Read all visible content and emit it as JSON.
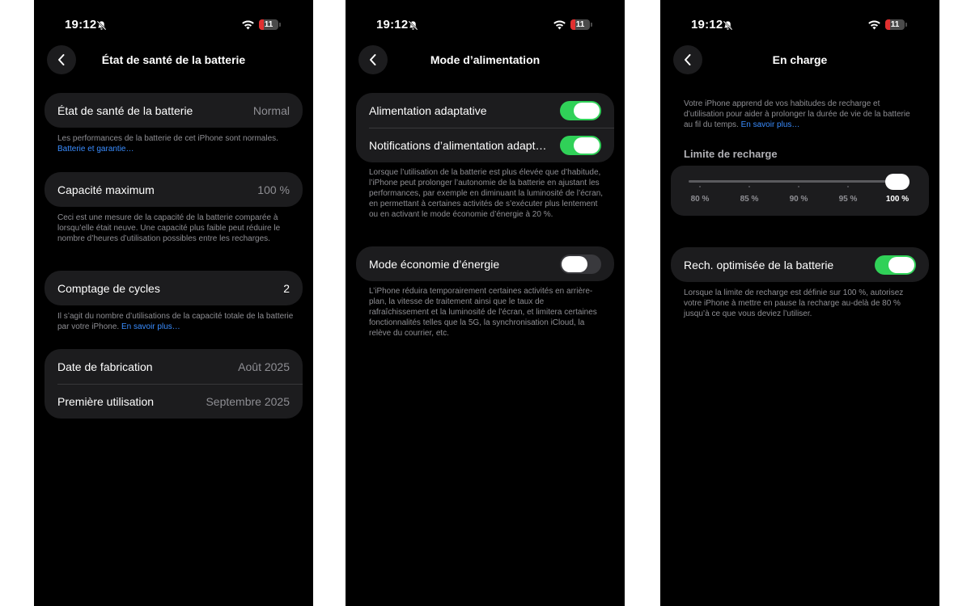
{
  "status_bar": {
    "time": "19:12",
    "battery": "11"
  },
  "screen1": {
    "title": "État de santé de la batterie",
    "health": {
      "label": "État de santé de la batterie",
      "value": "Normal"
    },
    "health_note": "Les performances de la batterie de cet iPhone sont normales.",
    "health_link": "Batterie et garantie…",
    "capacity": {
      "label": "Capacité maximum",
      "value": "100 %"
    },
    "capacity_note": "Ceci est une mesure de la capacité de la batterie comparée à lorsqu’elle était neuve. Une capacité plus faible peut réduire le nombre d’heures d’utilisation possibles entre les recharges.",
    "cycles": {
      "label": "Comptage de cycles",
      "value": "2"
    },
    "cycles_note": "Il s’agit du nombre d’utilisations de la capacité totale de la batterie par votre iPhone.",
    "cycles_link": "En savoir plus…",
    "manufacture": {
      "label": "Date de fabrication",
      "value": "Août 2025"
    },
    "first_use": {
      "label": "Première utilisation",
      "value": "Septembre 2025"
    }
  },
  "screen2": {
    "title": "Mode d’alimentation",
    "adaptive": {
      "label": "Alimentation adaptative",
      "on": true
    },
    "notifications": {
      "label": "Notifications d’alimentation adaptative",
      "on": true
    },
    "adaptive_note": "Lorsque l’utilisation de la batterie est plus élevée que d’habitude, l’iPhone peut prolonger l’autonomie de la batterie en ajustant les performances, par exemple en diminuant la luminosité de l’écran, en permettant à certaines activités de s’exécuter plus lentement ou en activant le mode économie d’énergie à 20 %.",
    "low_power": {
      "label": "Mode économie d’énergie",
      "on": false
    },
    "low_power_note": "L’iPhone réduira temporairement certaines activités en arrière-plan, la vitesse de traitement ainsi que le taux de rafraîchissement et la luminosité de l’écran, et limitera certaines fonctionnalités telles que la 5G, la synchronisation iCloud, la relève du courrier, etc."
  },
  "screen3": {
    "title": "En charge",
    "intro": "Votre iPhone apprend de vos habitudes de recharge et d’utilisation pour aider à prolonger la durée de vie de la batterie au fil du temps.",
    "intro_link": "En savoir plus…",
    "limit_header": "Limite de recharge",
    "limit_ticks": [
      "80 %",
      "85 %",
      "90 %",
      "95 %",
      "100 %"
    ],
    "limit_selected_index": 4,
    "optimized": {
      "label": "Rech. optimisée de la batterie",
      "on": true
    },
    "optimized_note": "Lorsque la limite de recharge est définie sur 100 %, autorisez votre iPhone à mettre en pause la recharge au-delà de 80 % jusqu’à ce que vous deviez l’utiliser."
  },
  "colors": {
    "accent_green": "#30d158",
    "link_blue": "#3a8dff",
    "battery_low": "#e03030"
  },
  "icons": [
    "chevron-left-icon",
    "bell-slash-icon",
    "wifi-icon",
    "battery-icon"
  ]
}
